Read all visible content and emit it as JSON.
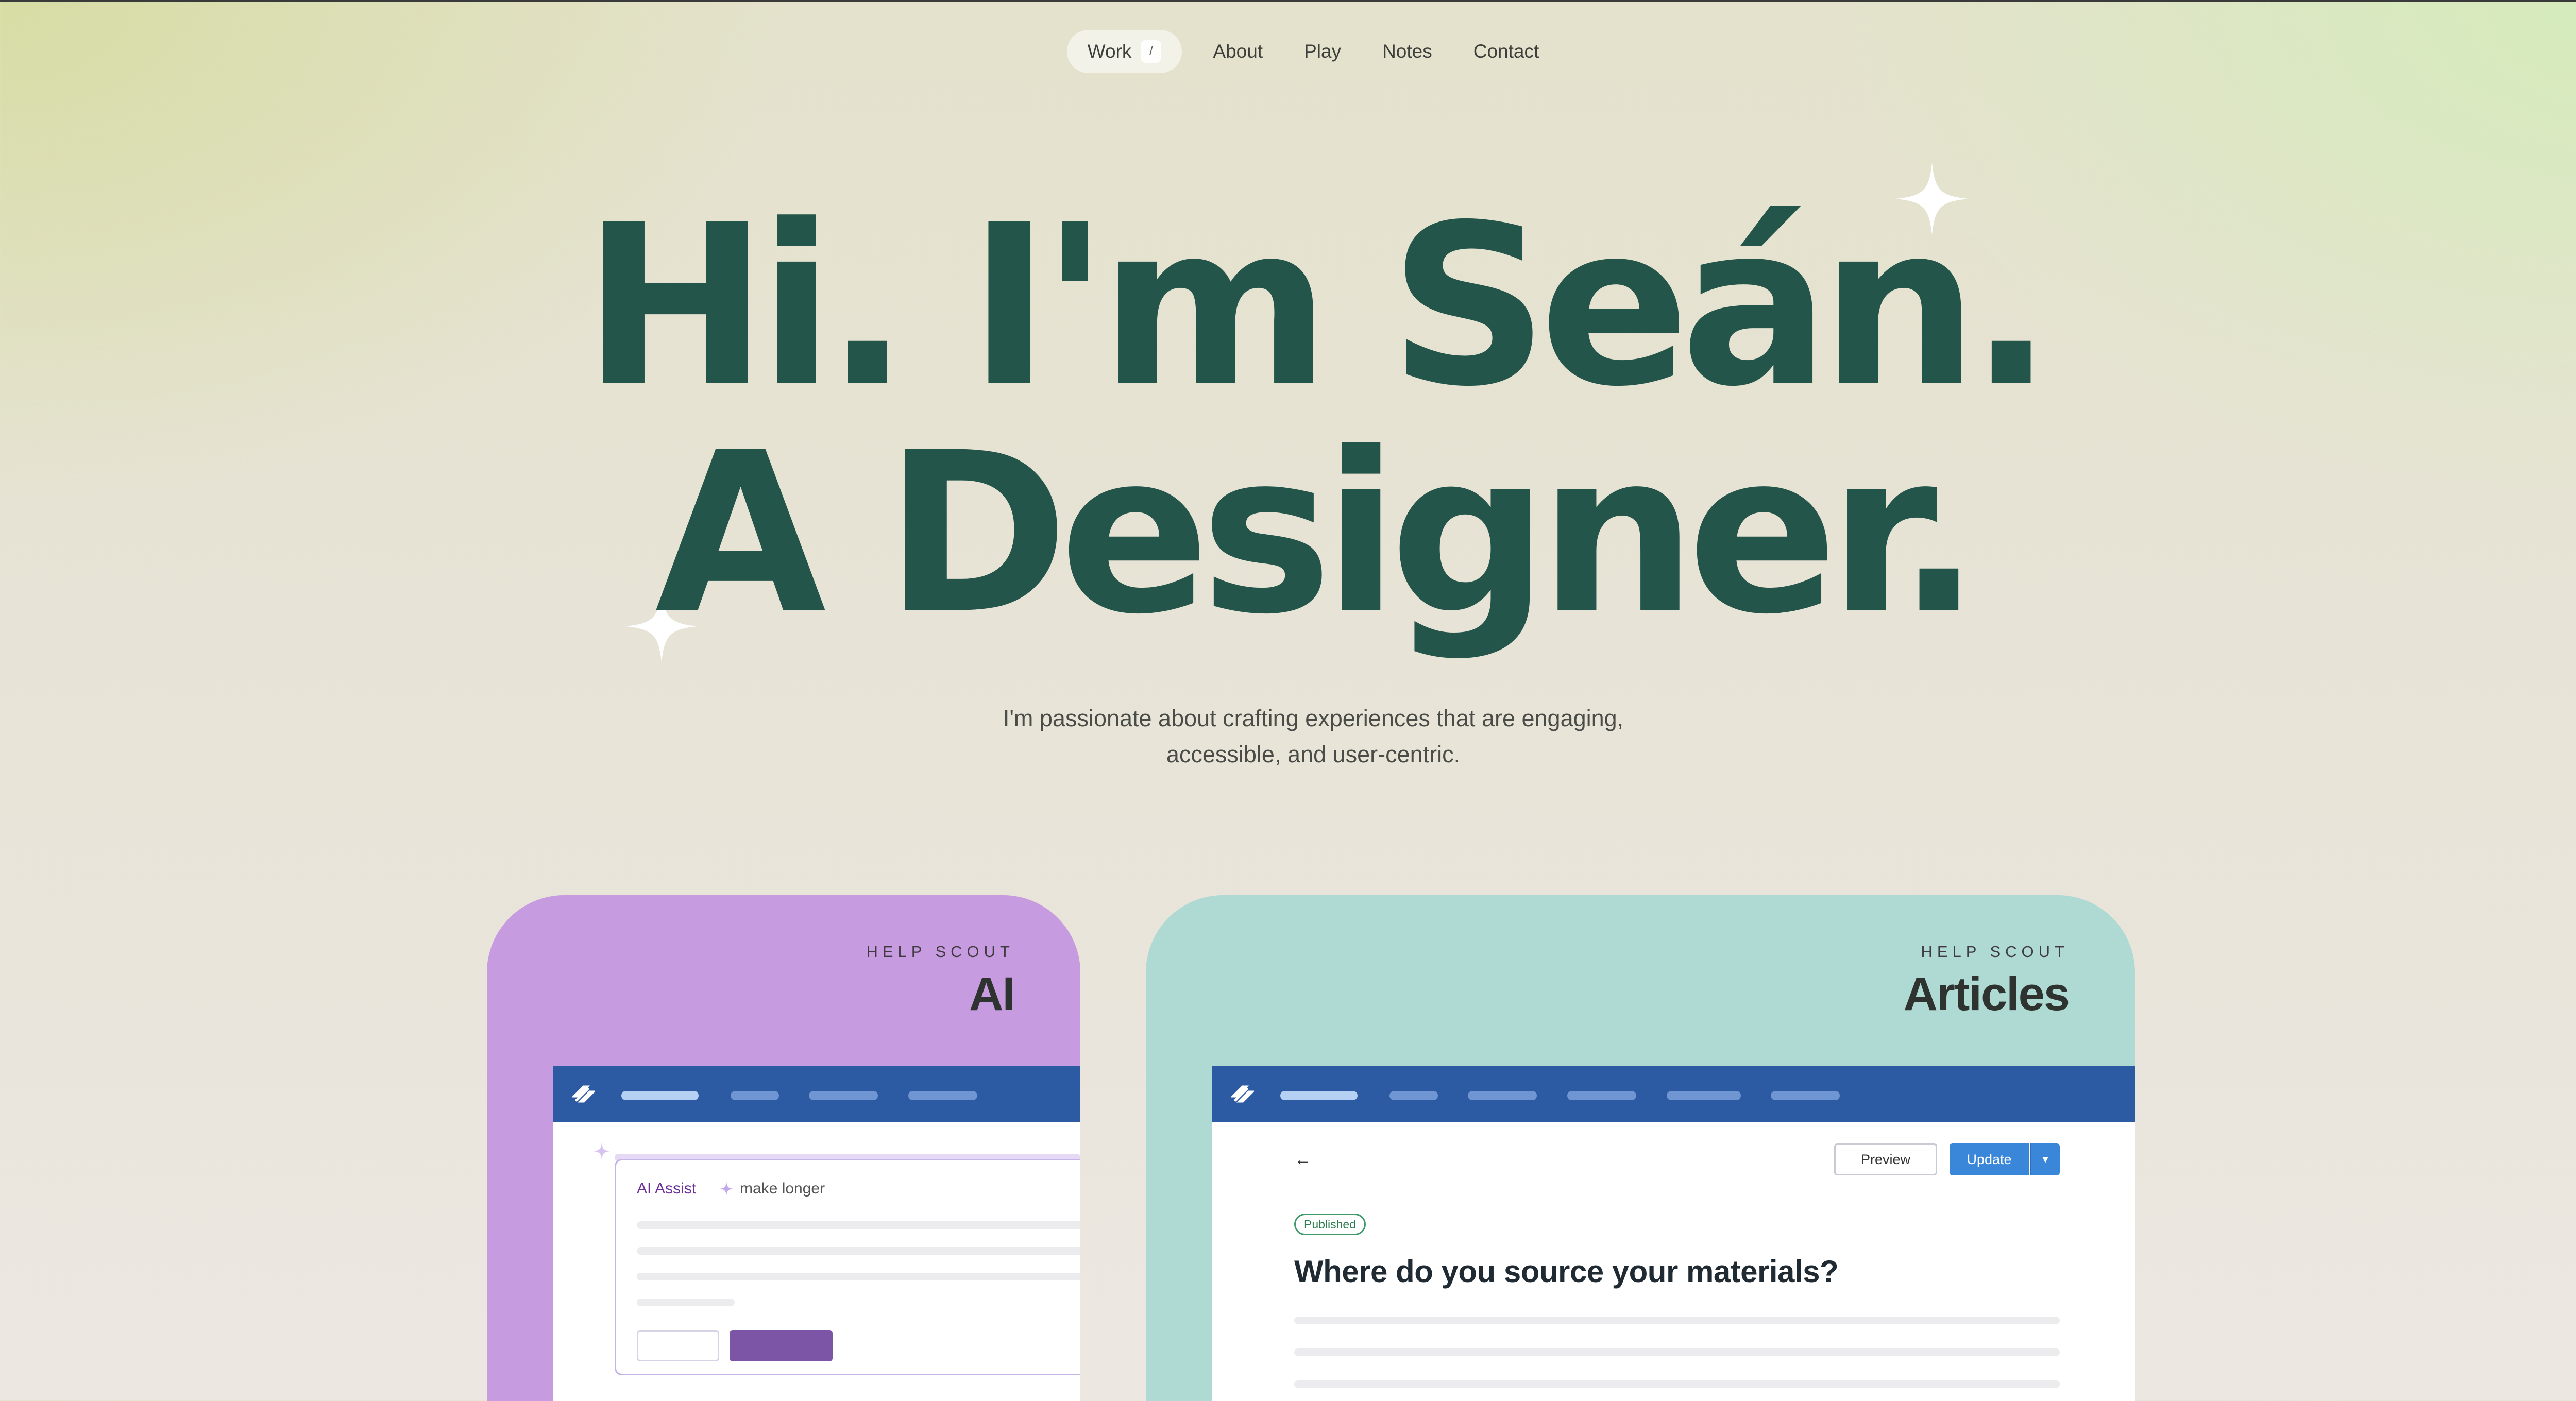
{
  "nav": {
    "items": [
      {
        "label": "Work",
        "active": true,
        "shortcut": "/"
      },
      {
        "label": "About"
      },
      {
        "label": "Play"
      },
      {
        "label": "Notes"
      },
      {
        "label": "Contact"
      }
    ]
  },
  "hero": {
    "line1": "Hi. I'm Seán.",
    "line2": "A Designer.",
    "subtitle_line1": "I'm passionate about crafting experiences that are engaging,",
    "subtitle_line2": "accessible, and user-centric."
  },
  "cards": {
    "ai": {
      "kicker": "HELP SCOUT",
      "title": "AI",
      "assist_label": "AI Assist",
      "assist_hint": "make longer"
    },
    "articles": {
      "kicker": "HELP SCOUT",
      "title": "Articles",
      "preview_label": "Preview",
      "update_label": "Update",
      "badge": "Published",
      "article_title": "Where do you source your materials?"
    }
  },
  "colors": {
    "headline": "#23554a",
    "ai_card": "#c69be0",
    "articles_card": "#afdad4",
    "app_bar": "#2c5aa3",
    "primary_button": "#3a86d8"
  }
}
